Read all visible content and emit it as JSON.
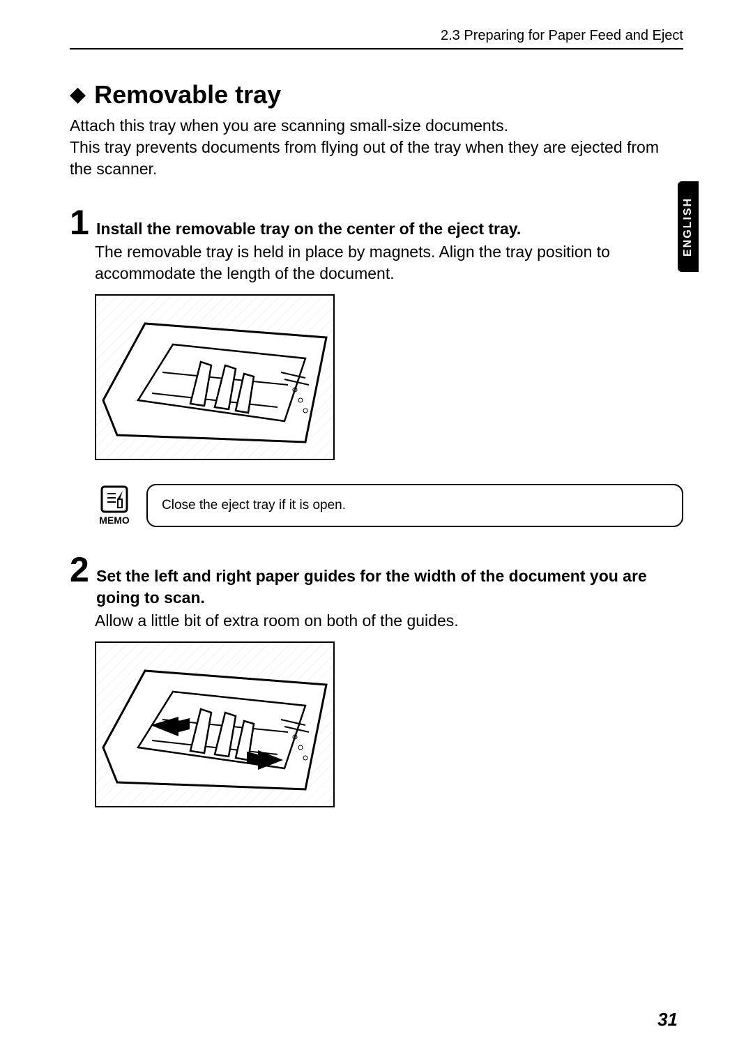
{
  "header": {
    "section_ref": "2.3   Preparing for Paper Feed and Eject"
  },
  "lang_tab": "ENGLISH",
  "title": "Removable tray",
  "intro": "Attach this tray when you are scanning small-size documents.\nThis tray prevents documents from flying out of the tray when they are ejected from the scanner.",
  "steps": [
    {
      "number": "1",
      "heading": "Install the removable tray on the center of the eject tray.",
      "body": "The removable tray is held in place by magnets. Align the tray position to accommodate the length of the document."
    },
    {
      "number": "2",
      "heading": "Set the left and right paper guides for the width of the document you are going to scan.",
      "body": "Allow a little bit of extra room on both of the guides."
    }
  ],
  "memo": {
    "label": "MEMO",
    "text": "Close the eject tray if it is open."
  },
  "page_number": "31"
}
